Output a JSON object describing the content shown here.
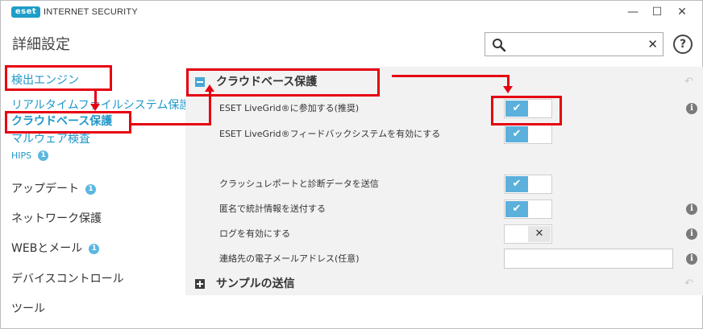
{
  "app": {
    "logo_text": "eset",
    "title": "INTERNET SECURITY",
    "minimize": "—",
    "maximize": "☐",
    "close": "✕"
  },
  "header": {
    "page_title": "詳細設定",
    "search_placeholder": "",
    "search_value": "",
    "search_clear": "✕",
    "help": "?"
  },
  "sidebar": {
    "items": [
      {
        "label": "検出エンジン",
        "level": "sub"
      },
      {
        "label": "リアルタイムファイルシステム保護",
        "level": "sub"
      },
      {
        "label": "クラウドベース保護",
        "level": "sub",
        "active": true
      },
      {
        "label": "マルウェア検査",
        "level": "sub"
      },
      {
        "label": "HIPS",
        "level": "sub-small",
        "badge": "1"
      },
      {
        "label": "アップデート",
        "level": "main",
        "badge": "1"
      },
      {
        "label": "ネットワーク保護",
        "level": "main"
      },
      {
        "label": "WEBとメール",
        "level": "main",
        "badge": "1"
      },
      {
        "label": "デバイスコントロール",
        "level": "main"
      },
      {
        "label": "ツール",
        "level": "main"
      }
    ]
  },
  "sections": [
    {
      "title": "クラウドベース保護",
      "expanded": true,
      "rows": [
        {
          "label": "ESET LiveGrid®に参加する(推奨)",
          "control": "toggle",
          "state": "on",
          "info": true
        },
        {
          "label": "ESET LiveGrid®フィードバックシステムを有効にする",
          "control": "toggle",
          "state": "on",
          "info": false
        },
        {
          "label": "クラッシュレポートと診断データを送信",
          "control": "toggle",
          "state": "on",
          "info": false
        },
        {
          "label": "匿名で統計情報を送付する",
          "control": "toggle",
          "state": "on",
          "info": true
        },
        {
          "label": "ログを有効にする",
          "control": "toggle",
          "state": "off",
          "info": true
        },
        {
          "label": "連絡先の電子メールアドレス(任意)",
          "control": "text",
          "value": "",
          "info": true
        }
      ]
    },
    {
      "title": "サンプルの送信",
      "expanded": false
    }
  ],
  "icons": {
    "toggle_on": "✔",
    "toggle_off": "✕",
    "info": "i",
    "revert": "↶"
  },
  "colors": {
    "accent": "#2197c9",
    "toggle_on": "#5bb0dc",
    "annotation": "#e60012",
    "content_bg": "#f2f2f2",
    "logo": "#1e9ec8"
  }
}
